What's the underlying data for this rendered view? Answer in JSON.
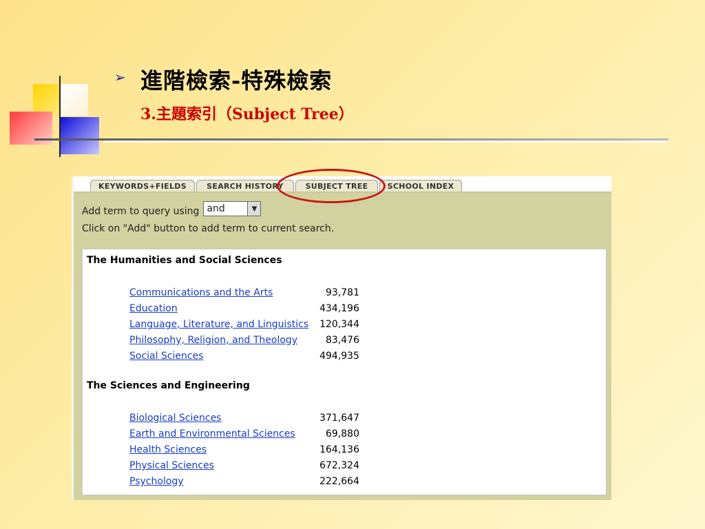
{
  "slide": {
    "title": "進階檢索-特殊檢索",
    "subtitle": "3.主題索引（Subject Tree）",
    "title_color": "#000000",
    "subtitle_color": "#cc0000"
  },
  "tabs": [
    {
      "label": "KEYWORDS+FIELDS"
    },
    {
      "label": "SEARCH HISTORY"
    },
    {
      "label": "SUBJECT TREE"
    },
    {
      "label": "SCHOOL INDEX"
    }
  ],
  "controls": {
    "add_term_label": "Add term to query using",
    "operator_value": "and",
    "instruction": "Click on \"Add\" button to add term to current search."
  },
  "sections": [
    {
      "heading": "The Humanities and Social Sciences",
      "items": [
        {
          "label": "Communications and the Arts",
          "count": "93,781"
        },
        {
          "label": "Education",
          "count": "434,196"
        },
        {
          "label": "Language, Literature, and Linguistics",
          "count": "120,344"
        },
        {
          "label": "Philosophy, Religion, and Theology",
          "count": "83,476"
        },
        {
          "label": "Social Sciences",
          "count": "494,935"
        }
      ]
    },
    {
      "heading": "The Sciences and Engineering",
      "items": [
        {
          "label": "Biological Sciences",
          "count": "371,647"
        },
        {
          "label": "Earth and Environmental Sciences",
          "count": "69,880"
        },
        {
          "label": "Health Sciences",
          "count": "164,136"
        },
        {
          "label": "Physical Sciences",
          "count": "672,324"
        },
        {
          "label": "Psychology",
          "count": "222,664"
        }
      ]
    }
  ],
  "colors": {
    "link": "#1a3cc8",
    "highlight_circle": "#c81414",
    "panel_bg": "#d2d1a0"
  }
}
